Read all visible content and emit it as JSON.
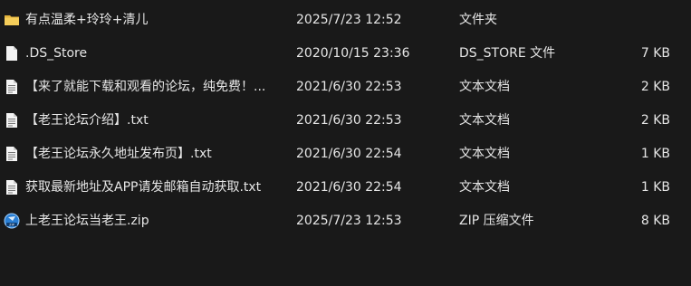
{
  "files": [
    {
      "name": "有点温柔+玲玲+清儿",
      "date": "2025/7/23 12:52",
      "type": "文件夹",
      "size": "",
      "icon": "folder-icon"
    },
    {
      "name": ".DS_Store",
      "date": "2020/10/15 23:36",
      "type": "DS_STORE 文件",
      "size": "7 KB",
      "icon": "blank-file-icon"
    },
    {
      "name": "【来了就能下载和观看的论坛，纯免费！...",
      "date": "2021/6/30 22:53",
      "type": "文本文档",
      "size": "2 KB",
      "icon": "text-file-icon"
    },
    {
      "name": "【老王论坛介绍】.txt",
      "date": "2021/6/30 22:53",
      "type": "文本文档",
      "size": "2 KB",
      "icon": "text-file-icon"
    },
    {
      "name": "【老王论坛永久地址发布页】.txt",
      "date": "2021/6/30 22:54",
      "type": "文本文档",
      "size": "1 KB",
      "icon": "text-file-icon"
    },
    {
      "name": "获取最新地址及APP请发邮箱自动获取.txt",
      "date": "2021/6/30 22:54",
      "type": "文本文档",
      "size": "1 KB",
      "icon": "text-file-icon"
    },
    {
      "name": "上老王论坛当老王.zip",
      "date": "2025/7/23 12:53",
      "type": "ZIP 压缩文件",
      "size": "8 KB",
      "icon": "zip-file-icon"
    }
  ],
  "colors": {
    "background": "#191919",
    "text": "#e6e6e6",
    "folder": "#f0c552",
    "zip_accent": "#2a7fd4"
  }
}
